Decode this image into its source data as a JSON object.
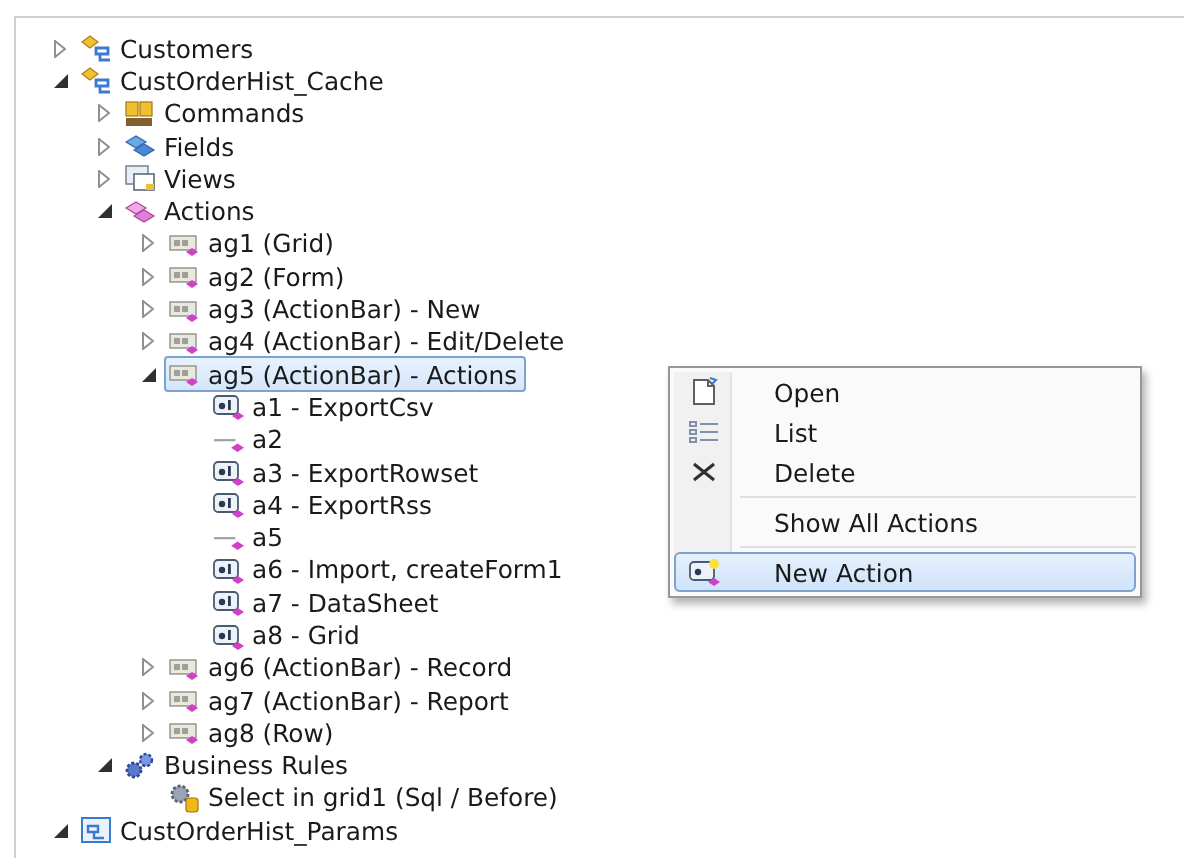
{
  "tree": [
    {
      "label": "Customers",
      "kind": "entity",
      "expanded": false,
      "selected": false
    },
    {
      "label": "CustOrderHist_Cache",
      "kind": "entity",
      "expanded": true,
      "selected": false,
      "children": [
        {
          "label": "Commands",
          "kind": "sql",
          "expanded": false,
          "selected": false
        },
        {
          "label": "Fields",
          "kind": "fields",
          "expanded": false,
          "selected": false
        },
        {
          "label": "Views",
          "kind": "views",
          "expanded": false,
          "selected": false
        },
        {
          "label": "Actions",
          "kind": "actions",
          "expanded": true,
          "selected": false,
          "children": [
            {
              "label": "ag1 (Grid)",
              "kind": "group",
              "expanded": false,
              "selected": false
            },
            {
              "label": "ag2 (Form)",
              "kind": "group",
              "expanded": false,
              "selected": false
            },
            {
              "label": "ag3 (ActionBar) - New",
              "kind": "group",
              "expanded": false,
              "selected": false
            },
            {
              "label": "ag4 (ActionBar) - Edit/Delete",
              "kind": "group",
              "expanded": false,
              "selected": false
            },
            {
              "label": "ag5 (ActionBar) - Actions",
              "kind": "group",
              "expanded": true,
              "selected": true,
              "children": [
                {
                  "label": "a1 - ExportCsv",
                  "kind": "action",
                  "selected": false
                },
                {
                  "label": "a2",
                  "kind": "stub",
                  "selected": false
                },
                {
                  "label": "a3 - ExportRowset",
                  "kind": "action",
                  "selected": false
                },
                {
                  "label": "a4 - ExportRss",
                  "kind": "action",
                  "selected": false
                },
                {
                  "label": "a5",
                  "kind": "stub",
                  "selected": false
                },
                {
                  "label": "a6 - Import, createForm1",
                  "kind": "action",
                  "selected": false
                },
                {
                  "label": "a7 - DataSheet",
                  "kind": "action",
                  "selected": false
                },
                {
                  "label": "a8 - Grid",
                  "kind": "action",
                  "selected": false
                }
              ]
            },
            {
              "label": "ag6 (ActionBar) - Record",
              "kind": "group",
              "expanded": false,
              "selected": false
            },
            {
              "label": "ag7 (ActionBar) - Report",
              "kind": "group",
              "expanded": false,
              "selected": false
            },
            {
              "label": "ag8 (Row)",
              "kind": "group",
              "expanded": false,
              "selected": false
            }
          ]
        },
        {
          "label": "Business Rules",
          "kind": "rules",
          "expanded": true,
          "selected": false,
          "children": [
            {
              "label": "Select in grid1 (Sql / Before)",
              "kind": "rule",
              "selected": false
            }
          ]
        }
      ]
    },
    {
      "label": "CustOrderHist_Params",
      "kind": "params",
      "expanded": true,
      "selected": false
    }
  ],
  "context_menu": {
    "items": [
      {
        "label": "Open",
        "kind": "open",
        "selected": false
      },
      {
        "label": "List",
        "kind": "list",
        "selected": false
      },
      {
        "label": "Delete",
        "kind": "delete",
        "selected": false
      },
      {
        "kind": "separator"
      },
      {
        "label": "Show All Actions",
        "kind": "plain",
        "selected": false
      },
      {
        "kind": "separator"
      },
      {
        "label": "New Action",
        "kind": "new",
        "selected": true
      }
    ]
  }
}
